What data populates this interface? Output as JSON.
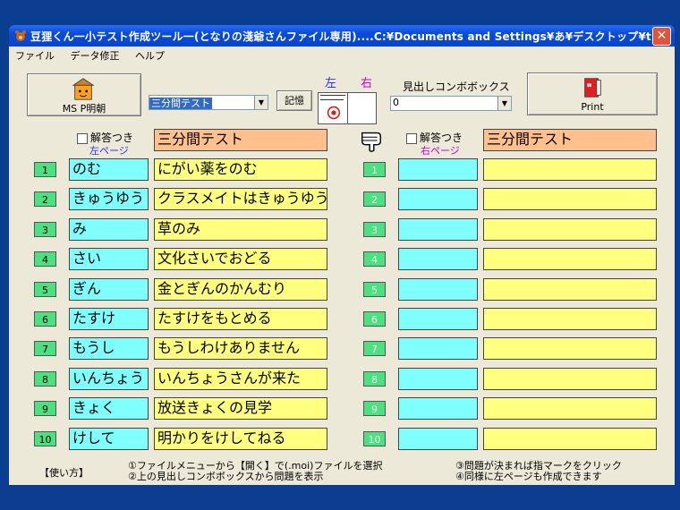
{
  "window": {
    "title": "豆狸くん一小テスト作成ツール一(となりの淺爺さんファイル専用)....C:¥Documents and Settings¥あ¥デスクトップ¥tk...",
    "close_label": "✕"
  },
  "menu": [
    "ファイル",
    "データ修正",
    "ヘルプ"
  ],
  "toolbar": {
    "ms_button_label": "MS P明朝",
    "test_select_value": "三分間テスト",
    "kioku_button_label": "記憶",
    "left_label": "左",
    "right_label": "右",
    "heading_combo_label": "見出しコンボボックス",
    "heading_combo_value": "0",
    "print_button_label": "Print"
  },
  "left_page": {
    "answer_checkbox_label": "解答つき",
    "page_label": "左ページ",
    "title": "三分間テスト",
    "rows": [
      {
        "num": "1",
        "reading": "のむ",
        "sentence": "にがい薬をのむ"
      },
      {
        "num": "2",
        "reading": "きゅうゆう",
        "sentence": "クラスメイトはきゅうゆう"
      },
      {
        "num": "3",
        "reading": "み",
        "sentence": "草のみ"
      },
      {
        "num": "4",
        "reading": "さい",
        "sentence": "文化さいでおどる"
      },
      {
        "num": "5",
        "reading": "ぎん",
        "sentence": "金とぎんのかんむり"
      },
      {
        "num": "6",
        "reading": "たすけ",
        "sentence": "たすけをもとめる"
      },
      {
        "num": "7",
        "reading": "もうし",
        "sentence": "もうしわけありません"
      },
      {
        "num": "8",
        "reading": "いんちょう",
        "sentence": "いんちょうさんが来た"
      },
      {
        "num": "9",
        "reading": "きょく",
        "sentence": "放送きょくの見学"
      },
      {
        "num": "10",
        "reading": "けして",
        "sentence": "明かりをけしてねる"
      }
    ]
  },
  "right_page": {
    "answer_checkbox_label": "解答つき",
    "page_label": "右ページ",
    "title": "三分間テスト",
    "rows": [
      {
        "num": "1",
        "reading": "",
        "sentence": ""
      },
      {
        "num": "2",
        "reading": "",
        "sentence": ""
      },
      {
        "num": "3",
        "reading": "",
        "sentence": ""
      },
      {
        "num": "4",
        "reading": "",
        "sentence": ""
      },
      {
        "num": "5",
        "reading": "",
        "sentence": ""
      },
      {
        "num": "6",
        "reading": "",
        "sentence": ""
      },
      {
        "num": "7",
        "reading": "",
        "sentence": ""
      },
      {
        "num": "8",
        "reading": "",
        "sentence": ""
      },
      {
        "num": "9",
        "reading": "",
        "sentence": ""
      },
      {
        "num": "10",
        "reading": "",
        "sentence": ""
      }
    ]
  },
  "footer": {
    "howto_label": "【使い方】",
    "step1": "①ファイルメニューから【開く】で(.moi)ファイルを選択",
    "step2": "②上の見出しコンボボックスから問題を表示",
    "step3": "③問題が決まれば指マークをクリック",
    "step4": "④同様に左ページも作成できます"
  },
  "colors": {
    "reading_field": "#80ffff",
    "sentence_field": "#ffff80",
    "title_field": "#ffc08c",
    "number_badge": "#4ce080",
    "left_label_color": "#3030ff",
    "right_label_color": "#d000d0"
  }
}
